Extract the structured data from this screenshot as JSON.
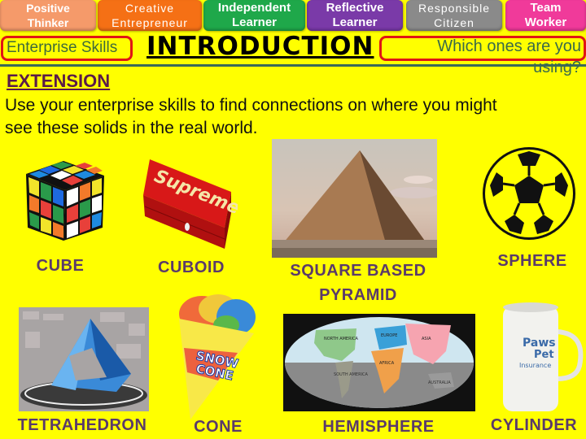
{
  "skills_bar": [
    {
      "line1": "Positive",
      "line2": "Thinker",
      "color": "#f59a6a"
    },
    {
      "line1": "Creative",
      "line2": "Entrepreneur",
      "color": "#f57015"
    },
    {
      "line1": "Independent",
      "line2": "Learner",
      "color": "#1fa84a"
    },
    {
      "line1": "Reflective",
      "line2": "Learner",
      "color": "#7a3aa8"
    },
    {
      "line1": "Responsible",
      "line2": "Citizen",
      "color": "#8a8a8a"
    },
    {
      "line1": "Team",
      "line2": "Worker",
      "color": "#f03a9a"
    }
  ],
  "header": {
    "enterprise_label": "Enterprise Skills",
    "title": "INTRODUCTION",
    "question": "Which ones are you using?",
    "question_line1": "Which ones are you",
    "question_line2": "using?"
  },
  "extension": {
    "heading": "EXTENSION",
    "instruction_line1": "Use your enterprise skills to find connections on where you might",
    "instruction_line2": "see these solids in the real world."
  },
  "solids": [
    {
      "name": "CUBE",
      "image": "rubiks-cube"
    },
    {
      "name": "CUBOID",
      "image": "supreme-box"
    },
    {
      "name": "SQUARE BASED",
      "name2": "PYRAMID",
      "image": "egyptian-pyramid"
    },
    {
      "name": "SPHERE",
      "image": "football"
    },
    {
      "name": "TETRAHEDRON",
      "image": "tetrahedron-building"
    },
    {
      "name": "CONE",
      "image": "snow-cone"
    },
    {
      "name": "HEMISPHERE",
      "image": "world-map"
    },
    {
      "name": "CYLINDER",
      "image": "paws-pet-mug"
    }
  ],
  "image_text": {
    "supreme": "Supreme",
    "snow": "SNOW",
    "cone": "CONE",
    "paws": "Paws",
    "pet": "Pet",
    "insurance": "Insurance",
    "north_america": "NORTH AMERICA",
    "south_america": "SOUTH AMERICA",
    "europe": "EUROPE",
    "asia": "ASIA",
    "africa": "AFRICA",
    "australia": "AUSTRALIA"
  },
  "colors": {
    "background": "#ffff00",
    "label_purple": "#5a3a6a",
    "red_outline": "#e01515"
  }
}
